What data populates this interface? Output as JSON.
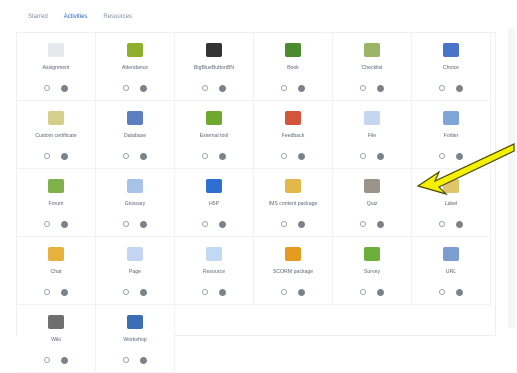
{
  "tabs": [
    {
      "label": "Starred",
      "active": false
    },
    {
      "label": "Activities",
      "active": true
    },
    {
      "label": "Resources",
      "active": false
    }
  ],
  "items": [
    {
      "label": "Assignment",
      "icon": "assignment-icon",
      "color": "#e6e8eb"
    },
    {
      "label": "Attendance",
      "icon": "attendance-icon",
      "color": "#8fae2c"
    },
    {
      "label": "BigBlueButtonBN",
      "icon": "bigbluebutton-icon",
      "color": "#333333"
    },
    {
      "label": "Book",
      "icon": "book-icon",
      "color": "#4a8b2f"
    },
    {
      "label": "Checklist",
      "icon": "checklist-icon",
      "color": "#99b565"
    },
    {
      "label": "Choice",
      "icon": "choice-icon",
      "color": "#4a74c9"
    },
    {
      "label": "Custom certificate",
      "icon": "certificate-icon",
      "color": "#d4cf8a"
    },
    {
      "label": "Database",
      "icon": "database-icon",
      "color": "#5b7fc0"
    },
    {
      "label": "External tool",
      "icon": "external-tool-icon",
      "color": "#6ea82f"
    },
    {
      "label": "Feedback",
      "icon": "feedback-icon",
      "color": "#d1563c"
    },
    {
      "label": "File",
      "icon": "file-icon",
      "color": "#c5d6f0"
    },
    {
      "label": "Folder",
      "icon": "folder-icon",
      "color": "#7fa6d8"
    },
    {
      "label": "Forum",
      "icon": "forum-icon",
      "color": "#7fb04a"
    },
    {
      "label": "Glossary",
      "icon": "glossary-icon",
      "color": "#a9c2ea"
    },
    {
      "label": "H5P",
      "icon": "h5p-icon",
      "color": "#2f6fd1"
    },
    {
      "label": "IMS content package",
      "icon": "ims-package-icon",
      "color": "#e3b84a"
    },
    {
      "label": "Quiz",
      "icon": "quiz-icon",
      "color": "#9a948a"
    },
    {
      "label": "Label",
      "icon": "label-icon",
      "color": "#e0c46a"
    },
    {
      "label": "Chat",
      "icon": "chat-icon",
      "color": "#e6b23c"
    },
    {
      "label": "Page",
      "icon": "page-icon",
      "color": "#c4d6f2"
    },
    {
      "label": "Resource",
      "icon": "resource-icon",
      "color": "#c2d9f3"
    },
    {
      "label": "SCORM package",
      "icon": "scorm-package-icon",
      "color": "#e39c1f"
    },
    {
      "label": "Survey",
      "icon": "survey-icon",
      "color": "#6caf3a"
    },
    {
      "label": "URL",
      "icon": "url-icon",
      "color": "#7b9dd0"
    },
    {
      "label": "Wiki",
      "icon": "wiki-icon",
      "color": "#6f6f6f"
    },
    {
      "label": "Workshop",
      "icon": "workshop-icon",
      "color": "#3a6fb8"
    }
  ],
  "colors": {
    "arrow_fill": "#f4f000",
    "arrow_stroke": "#4a4a00"
  }
}
